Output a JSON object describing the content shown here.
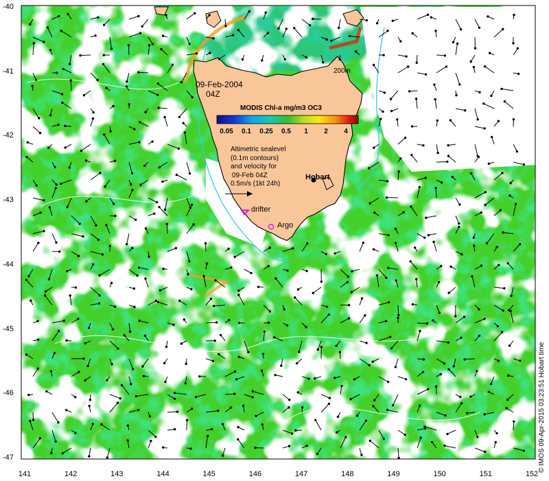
{
  "date_line": "09-Feb-2004",
  "time_line": "04Z",
  "depth_contour_label": "200m",
  "colorbar": {
    "title": "MODIS Chl-a mg/m3 OC3",
    "ticks": [
      "0.05",
      "0.1",
      "0.25",
      "0.5",
      "1",
      "2",
      "4"
    ]
  },
  "legend_text": [
    "Altimetric sealevel",
    "(0.1m contours)",
    "and velocity for",
    "09-Feb 04Z",
    "0.5m/s (1kt 24h)"
  ],
  "city_label": "Hobart",
  "drifter_label": "drifter",
  "argo_label": "Argo",
  "stamp": "© IMOS 09-Apr-2015 03:23:51 Hobart time",
  "x_ticks": [
    "141",
    "142",
    "143",
    "144",
    "145",
    "146",
    "147",
    "148",
    "149",
    "150",
    "151",
    "152"
  ],
  "y_ticks": [
    "-40",
    "-41",
    "-42",
    "-43",
    "-44",
    "-45",
    "-46",
    "-47"
  ],
  "colors": {
    "land": "#f9c69a",
    "coast": "#000000",
    "chl_low": "#1fb85a",
    "chl_mid": "#43d02b",
    "chl_high": "#f0a020",
    "contour_200m": "#35c8ee",
    "drifter": "#e020e0"
  }
}
